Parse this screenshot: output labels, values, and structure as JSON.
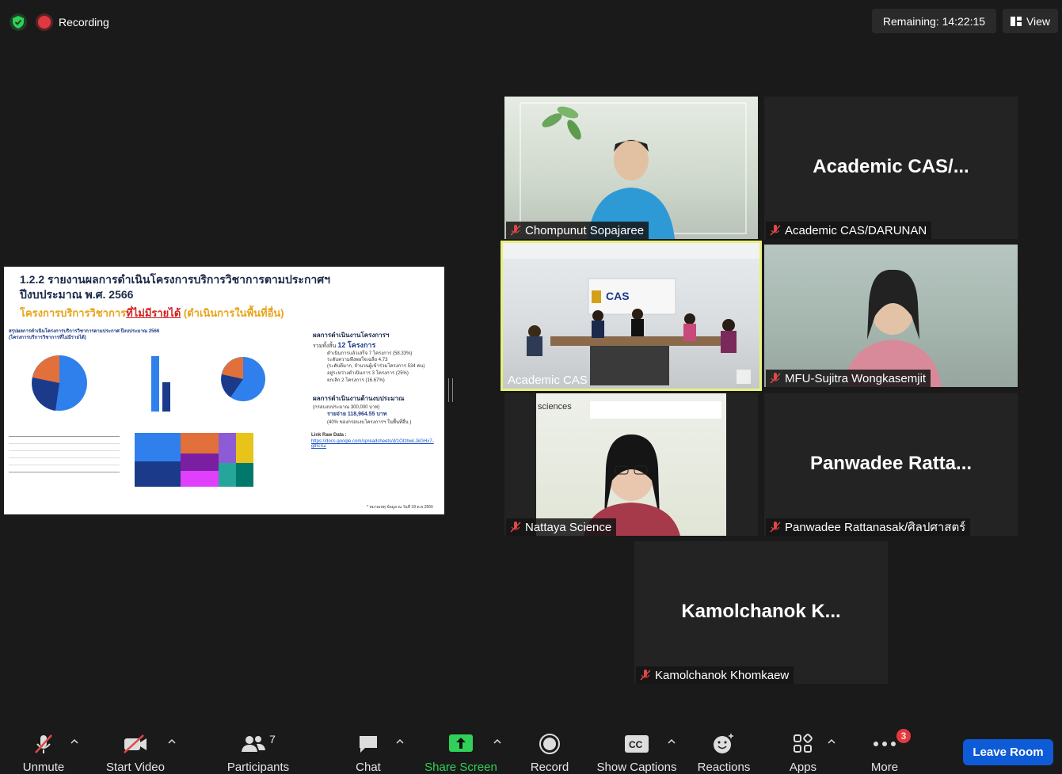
{
  "topbar": {
    "recording_label": "Recording",
    "remaining_label": "Remaining: 14:22:15",
    "view_label": "View"
  },
  "shared_screen": {
    "title_line1": "1.2.2 รายงานผลการดำเนินโครงการบริการวิชาการตามประกาศฯ",
    "title_line2": "ปีงบประมาณ พ.ศ. 2566",
    "subtitle_a": "โครงการบริการวิชาการ",
    "subtitle_b": "ที่ไม่มีรายได้",
    "subtitle_c": " (ดำเนินการในพื้นที่อื่น)",
    "summary_heading": "ผลการดำเนินงานโครงการฯ",
    "summary_total_prefix": "รวมทั้งสิ้น",
    "summary_total": "12 โครงการ",
    "item1": "ดำเนินการแล้วเสร็จ 7 โครงการ (58.33%)",
    "item1b": "ระดับความพึงพอใจเฉลี่ย 4.73",
    "item1c": "(ระดับดีมาก, จำนวนผู้เข้าร่วมโครงการ 534 คน)",
    "item2": "อยู่ระหว่างดำเนินการ 3 โครงการ (25%)",
    "item3": "ยกเลิก 2 โครงการ (16.67%)",
    "budget_heading": "ผลการดำเนินงานด้านงบประมาณ",
    "budget_frame": "(กรอบงบประมาณ 300,000 บาท)",
    "budget_spent": "รายจ่าย 118,964.55 บาท",
    "budget_pct": "(40% ของกรอบงบโครงการฯ ในพื้นที่อื่น )",
    "raw_label": "Link Raw Data :",
    "raw_link": "https://docs.google.com/spreadsheets/d/1OIzbwLJkGHx7-gthcXZ",
    "footnote": "* หมายเหตุ ข้อมูล ณ วันที่ 18 ต.ค.2566",
    "dash_title": "สรุปผลการดำเนินโครงการบริการวิชาการตามประกาศ ปีงบประมาณ 2566",
    "dash_sub": "(โครงการบริการวิชาการที่ไม่มีรายได้)"
  },
  "participants": [
    {
      "display": "",
      "name": "Chompunut Sopajaree",
      "muted": true
    },
    {
      "display": "Academic  CAS/...",
      "name": "Academic CAS/DARUNAN",
      "muted": true
    },
    {
      "display": "",
      "name": "Academic CAS",
      "muted": false,
      "active_speaker": true
    },
    {
      "display": "",
      "name": "MFU-Sujitra Wongkasemjit",
      "muted": true
    },
    {
      "display": "",
      "name": "Nattaya Science",
      "muted": true
    },
    {
      "display": "Panwadee  Ratta...",
      "name": "Panwadee Rattanasak/ศิลปศาสตร์",
      "muted": true
    },
    {
      "display": "Kamolchanok  K...",
      "name": "Kamolchanok Khomkaew",
      "muted": true
    }
  ],
  "toolbar": {
    "unmute": "Unmute",
    "start_video": "Start Video",
    "participants": "Participants",
    "participants_count": "7",
    "chat": "Chat",
    "share_screen": "Share Screen",
    "record": "Record",
    "show_captions": "Show Captions",
    "reactions": "Reactions",
    "apps": "Apps",
    "more": "More",
    "more_badge": "3",
    "leave_room": "Leave Room"
  },
  "colors": {
    "accent_green": "#2fd158",
    "leave_blue": "#0e5bd8",
    "active_border": "#e9f07a"
  }
}
